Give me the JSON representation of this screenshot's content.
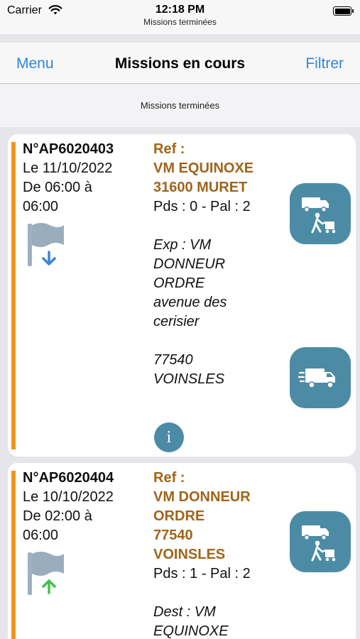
{
  "status_bar": {
    "carrier": "Carrier",
    "time": "12:18 PM",
    "subtitle": "Missions terminées",
    "icons": [
      "wifi-icon",
      "battery-icon"
    ]
  },
  "nav": {
    "left_label": "Menu",
    "title": "Missions en cours",
    "right_label": "Filtrer",
    "link_color": "#2f86d6"
  },
  "subheader": {
    "label": "Missions terminées"
  },
  "theme": {
    "accent": "#f0961e",
    "ref_color": "#a0651a",
    "button_color": "#4c8ba5",
    "flag_arrow_down": "#3a86d8",
    "flag_arrow_up": "#43c04a"
  },
  "missions": [
    {
      "number": "N°AP6020403",
      "date": "Le 11/10/2022",
      "time_line1": "De 06:00 à",
      "time_line2": "06:00",
      "flag_icon": "flag-arrow-down-icon",
      "ref_label": "Ref :",
      "ref_lines": [
        "VM EQUINOXE",
        "31600 MURET"
      ],
      "weight": "Pds : 0 - Pal : 2",
      "party_lines": [
        "Exp : VM",
        "DONNEUR",
        "ORDRE",
        "avenue des",
        "cerisier"
      ],
      "postal_lines": [
        "77540",
        "VOINSLES"
      ],
      "buttons": [
        "delivery-person-icon",
        "truck-icon"
      ],
      "info_label": "i"
    },
    {
      "number": "N°AP6020404",
      "date": "Le 10/10/2022",
      "time_line1": "De 02:00 à",
      "time_line2": "06:00",
      "flag_icon": "flag-arrow-up-icon",
      "ref_label": "Ref :",
      "ref_lines": [
        "VM DONNEUR",
        "ORDRE",
        "77540",
        "VOINSLES"
      ],
      "weight": "Pds : 1 - Pal : 2",
      "party_lines": [
        "Dest : VM",
        "EQUINOXE"
      ],
      "buttons": [
        "delivery-person-icon"
      ]
    }
  ]
}
